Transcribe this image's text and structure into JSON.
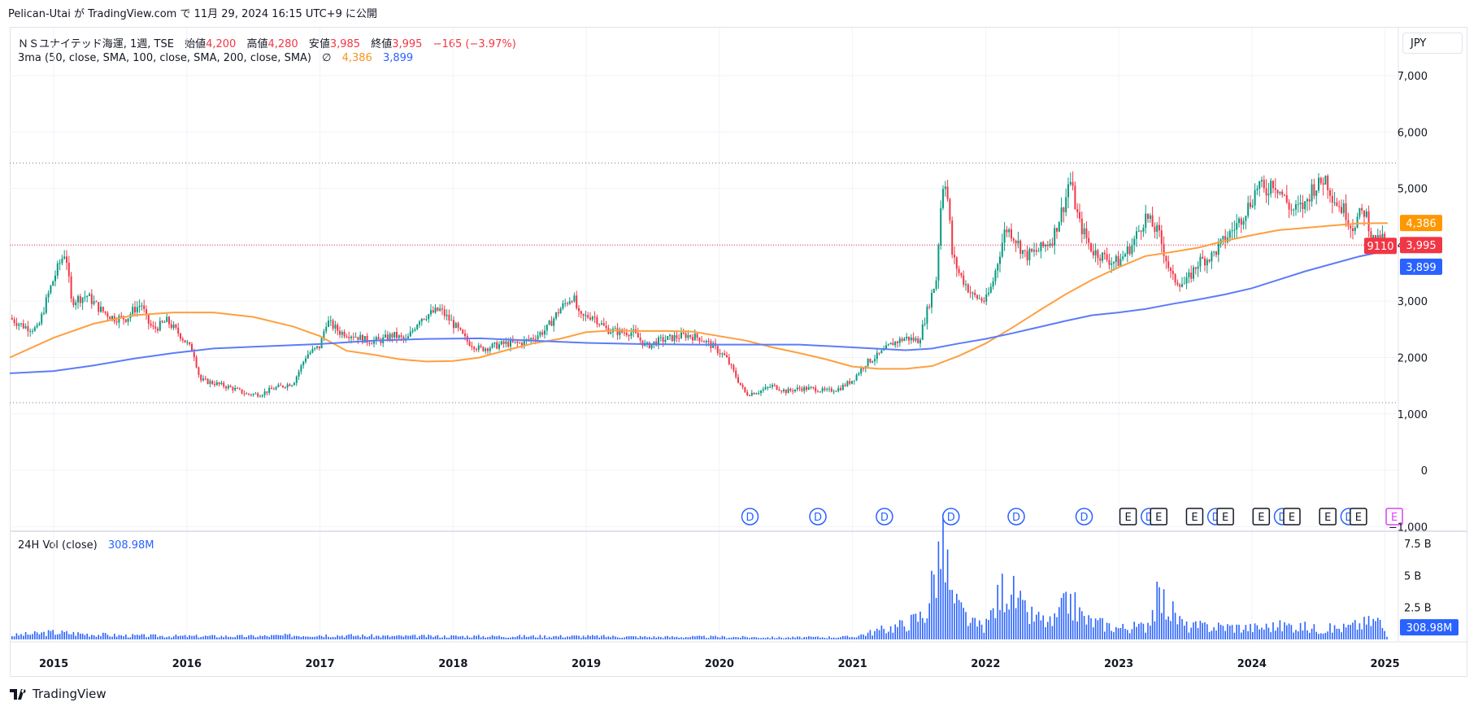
{
  "header": {
    "published_line": "Pelican-Utai が TradingView.com で 11月 29, 2024 16:15 UTC+9 に公開"
  },
  "legend": {
    "symbol": "ＮＳユナイテッド海運, 1週, TSE",
    "open_label": "始値",
    "open": "4,200",
    "high_label": "高値",
    "high": "4,280",
    "low_label": "安値",
    "low": "3,985",
    "close_label": "終値",
    "close": "3,995",
    "change": "−165 (−3.97%)",
    "indicator": "3ma (50, close, SMA, 100, close, SMA, 200, close, SMA)",
    "indicator_icon": "∅",
    "ma100_value": "4,386",
    "ma200_value": "3,899",
    "volume_label": "24H Vol (close)",
    "volume_value": "308.98M"
  },
  "currency": "JPY",
  "footer": {
    "brand": "TradingView"
  },
  "colors": {
    "up": "#089981",
    "down": "#f23645",
    "ma100": "#ff9f40",
    "ma200": "#5b7cfa",
    "volume": "#2962ff",
    "price_label": "#f23645",
    "ma100_label": "#ff9800",
    "ma200_label": "#2962ff"
  },
  "chart_data": {
    "type": "candlestick",
    "timeframe": "1W",
    "x_tick_labels": [
      "2015",
      "2016",
      "2017",
      "2018",
      "2019",
      "2020",
      "2021",
      "2022",
      "2023",
      "2024",
      "2025"
    ],
    "y_tick_labels": [
      "7,000",
      "6,000",
      "5,000",
      "4,000",
      "3,000",
      "2,000",
      "1,000",
      "0",
      "−1,000"
    ],
    "ylim": [
      -1000,
      7600
    ],
    "xlim": [
      2014.67,
      2025.1
    ],
    "horizontal_levels": [
      5450,
      1200
    ],
    "last_price_line": 3995,
    "price_labels": {
      "ticker": "9110",
      "last": "3,995",
      "ma100": "4,386",
      "ma200": "3,899"
    },
    "price_path": [
      [
        2014.67,
        2700
      ],
      [
        2014.78,
        2550
      ],
      [
        2014.88,
        2500
      ],
      [
        2014.95,
        3050
      ],
      [
        2015.0,
        3400
      ],
      [
        2015.05,
        3700
      ],
      [
        2015.09,
        3900
      ],
      [
        2015.13,
        3000
      ],
      [
        2015.25,
        3100
      ],
      [
        2015.35,
        2850
      ],
      [
        2015.45,
        2700
      ],
      [
        2015.55,
        2700
      ],
      [
        2015.6,
        2850
      ],
      [
        2015.66,
        2950
      ],
      [
        2015.7,
        2650
      ],
      [
        2015.75,
        2500
      ],
      [
        2015.85,
        2650
      ],
      [
        2015.95,
        2400
      ],
      [
        2016.05,
        2100
      ],
      [
        2016.1,
        1600
      ],
      [
        2016.2,
        1550
      ],
      [
        2016.35,
        1450
      ],
      [
        2016.45,
        1350
      ],
      [
        2016.55,
        1350
      ],
      [
        2016.65,
        1450
      ],
      [
        2016.8,
        1550
      ],
      [
        2016.85,
        1800
      ],
      [
        2016.9,
        2050
      ],
      [
        2017.0,
        2200
      ],
      [
        2017.05,
        2650
      ],
      [
        2017.15,
        2450
      ],
      [
        2017.25,
        2400
      ],
      [
        2017.35,
        2300
      ],
      [
        2017.45,
        2300
      ],
      [
        2017.55,
        2400
      ],
      [
        2017.65,
        2300
      ],
      [
        2017.75,
        2700
      ],
      [
        2017.9,
        2850
      ],
      [
        2018.0,
        2600
      ],
      [
        2018.1,
        2300
      ],
      [
        2018.2,
        2150
      ],
      [
        2018.3,
        2200
      ],
      [
        2018.4,
        2250
      ],
      [
        2018.5,
        2250
      ],
      [
        2018.6,
        2350
      ],
      [
        2018.7,
        2500
      ],
      [
        2018.8,
        2850
      ],
      [
        2018.9,
        3100
      ],
      [
        2018.95,
        2700
      ],
      [
        2019.05,
        2750
      ],
      [
        2019.15,
        2500
      ],
      [
        2019.25,
        2450
      ],
      [
        2019.35,
        2450
      ],
      [
        2019.45,
        2200
      ],
      [
        2019.55,
        2300
      ],
      [
        2019.65,
        2350
      ],
      [
        2019.75,
        2400
      ],
      [
        2019.85,
        2350
      ],
      [
        2019.95,
        2200
      ],
      [
        2020.05,
        2000
      ],
      [
        2020.15,
        1550
      ],
      [
        2020.2,
        1350
      ],
      [
        2020.3,
        1400
      ],
      [
        2020.4,
        1500
      ],
      [
        2020.5,
        1400
      ],
      [
        2020.6,
        1450
      ],
      [
        2020.7,
        1450
      ],
      [
        2020.8,
        1400
      ],
      [
        2020.9,
        1450
      ],
      [
        2021.0,
        1600
      ],
      [
        2021.1,
        1900
      ],
      [
        2021.2,
        2050
      ],
      [
        2021.3,
        2250
      ],
      [
        2021.4,
        2350
      ],
      [
        2021.5,
        2300
      ],
      [
        2021.58,
        3000
      ],
      [
        2021.63,
        3400
      ],
      [
        2021.66,
        4600
      ],
      [
        2021.69,
        5300
      ],
      [
        2021.72,
        4700
      ],
      [
        2021.75,
        3800
      ],
      [
        2021.8,
        3500
      ],
      [
        2021.9,
        3100
      ],
      [
        2022.0,
        3000
      ],
      [
        2022.05,
        3300
      ],
      [
        2022.15,
        4300
      ],
      [
        2022.2,
        4200
      ],
      [
        2022.3,
        3800
      ],
      [
        2022.4,
        3900
      ],
      [
        2022.5,
        4100
      ],
      [
        2022.6,
        4800
      ],
      [
        2022.63,
        5200
      ],
      [
        2022.7,
        4400
      ],
      [
        2022.8,
        3900
      ],
      [
        2022.95,
        3700
      ],
      [
        2023.0,
        3700
      ],
      [
        2023.1,
        4000
      ],
      [
        2023.2,
        4500
      ],
      [
        2023.3,
        4200
      ],
      [
        2023.4,
        3400
      ],
      [
        2023.5,
        3300
      ],
      [
        2023.6,
        3700
      ],
      [
        2023.7,
        3800
      ],
      [
        2023.8,
        4100
      ],
      [
        2023.9,
        4400
      ],
      [
        2024.0,
        4800
      ],
      [
        2024.05,
        5100
      ],
      [
        2024.1,
        4900
      ],
      [
        2024.15,
        5150
      ],
      [
        2024.2,
        5000
      ],
      [
        2024.3,
        4600
      ],
      [
        2024.4,
        4700
      ],
      [
        2024.45,
        5000
      ],
      [
        2024.5,
        5050
      ],
      [
        2024.55,
        5200
      ],
      [
        2024.6,
        4900
      ],
      [
        2024.65,
        4700
      ],
      [
        2024.7,
        4600
      ],
      [
        2024.75,
        4300
      ],
      [
        2024.8,
        4500
      ],
      [
        2024.85,
        4600
      ],
      [
        2024.88,
        4350
      ],
      [
        2024.9,
        4100
      ],
      [
        2024.95,
        4050
      ],
      [
        2024.98,
        4120
      ],
      [
        2025.0,
        4050
      ],
      [
        2025.02,
        3995
      ]
    ],
    "series": [
      {
        "name": "MA100",
        "points": [
          [
            2014.67,
            2000
          ],
          [
            2015.0,
            2350
          ],
          [
            2015.3,
            2600
          ],
          [
            2015.6,
            2750
          ],
          [
            2015.9,
            2800
          ],
          [
            2016.2,
            2800
          ],
          [
            2016.5,
            2720
          ],
          [
            2016.8,
            2550
          ],
          [
            2017.0,
            2380
          ],
          [
            2017.2,
            2120
          ],
          [
            2017.4,
            2050
          ],
          [
            2017.6,
            1970
          ],
          [
            2017.8,
            1930
          ],
          [
            2018.0,
            1940
          ],
          [
            2018.2,
            2000
          ],
          [
            2018.4,
            2130
          ],
          [
            2018.6,
            2250
          ],
          [
            2018.8,
            2330
          ],
          [
            2019.0,
            2450
          ],
          [
            2019.2,
            2480
          ],
          [
            2019.4,
            2470
          ],
          [
            2019.6,
            2470
          ],
          [
            2019.8,
            2460
          ],
          [
            2020.0,
            2380
          ],
          [
            2020.2,
            2300
          ],
          [
            2020.4,
            2180
          ],
          [
            2020.6,
            2080
          ],
          [
            2020.8,
            1970
          ],
          [
            2021.0,
            1840
          ],
          [
            2021.2,
            1800
          ],
          [
            2021.4,
            1800
          ],
          [
            2021.6,
            1850
          ],
          [
            2021.8,
            2030
          ],
          [
            2022.0,
            2250
          ],
          [
            2022.2,
            2530
          ],
          [
            2022.4,
            2830
          ],
          [
            2022.6,
            3120
          ],
          [
            2022.8,
            3380
          ],
          [
            2023.0,
            3600
          ],
          [
            2023.2,
            3800
          ],
          [
            2023.4,
            3870
          ],
          [
            2023.6,
            3950
          ],
          [
            2023.8,
            4070
          ],
          [
            2024.0,
            4170
          ],
          [
            2024.2,
            4260
          ],
          [
            2024.4,
            4300
          ],
          [
            2024.6,
            4340
          ],
          [
            2024.8,
            4380
          ],
          [
            2025.02,
            4386
          ]
        ]
      },
      {
        "name": "MA200",
        "points": [
          [
            2014.67,
            1720
          ],
          [
            2015.0,
            1760
          ],
          [
            2015.3,
            1860
          ],
          [
            2015.6,
            1980
          ],
          [
            2015.9,
            2080
          ],
          [
            2016.2,
            2160
          ],
          [
            2016.5,
            2190
          ],
          [
            2016.8,
            2220
          ],
          [
            2017.0,
            2240
          ],
          [
            2017.4,
            2300
          ],
          [
            2017.8,
            2330
          ],
          [
            2018.2,
            2340
          ],
          [
            2018.6,
            2300
          ],
          [
            2019.0,
            2260
          ],
          [
            2019.4,
            2240
          ],
          [
            2019.8,
            2230
          ],
          [
            2020.2,
            2230
          ],
          [
            2020.6,
            2230
          ],
          [
            2021.0,
            2180
          ],
          [
            2021.4,
            2130
          ],
          [
            2021.6,
            2160
          ],
          [
            2021.8,
            2250
          ],
          [
            2022.0,
            2330
          ],
          [
            2022.2,
            2430
          ],
          [
            2022.4,
            2540
          ],
          [
            2022.6,
            2650
          ],
          [
            2022.8,
            2750
          ],
          [
            2023.0,
            2800
          ],
          [
            2023.2,
            2860
          ],
          [
            2023.4,
            2950
          ],
          [
            2023.6,
            3030
          ],
          [
            2023.8,
            3120
          ],
          [
            2024.0,
            3230
          ],
          [
            2024.2,
            3380
          ],
          [
            2024.4,
            3530
          ],
          [
            2024.6,
            3660
          ],
          [
            2024.8,
            3790
          ],
          [
            2025.02,
            3899
          ]
        ]
      }
    ],
    "volume_axis_labels": [
      "7.5 B",
      "5 B",
      "2.5 B"
    ],
    "volume_last_label": "308.98M",
    "volume_profile": [
      [
        2014.67,
        0.3
      ],
      [
        2015.0,
        0.55
      ],
      [
        2015.5,
        0.3
      ],
      [
        2016.0,
        0.25
      ],
      [
        2016.5,
        0.25
      ],
      [
        2017.0,
        0.35
      ],
      [
        2017.5,
        0.25
      ],
      [
        2018.0,
        0.25
      ],
      [
        2018.5,
        0.25
      ],
      [
        2019.0,
        0.25
      ],
      [
        2019.5,
        0.2
      ],
      [
        2020.0,
        0.2
      ],
      [
        2020.5,
        0.15
      ],
      [
        2021.0,
        0.2
      ],
      [
        2021.2,
        0.7
      ],
      [
        2021.4,
        1.2
      ],
      [
        2021.55,
        2.0
      ],
      [
        2021.66,
        7.1
      ],
      [
        2021.7,
        6.4
      ],
      [
        2021.75,
        3.0
      ],
      [
        2021.9,
        1.2
      ],
      [
        2022.0,
        1.0
      ],
      [
        2022.15,
        4.4
      ],
      [
        2022.3,
        2.0
      ],
      [
        2022.5,
        1.2
      ],
      [
        2022.63,
        3.1
      ],
      [
        2022.75,
        1.5
      ],
      [
        2023.0,
        0.9
      ],
      [
        2023.2,
        1.0
      ],
      [
        2023.3,
        3.3
      ],
      [
        2023.5,
        1.0
      ],
      [
        2023.8,
        1.0
      ],
      [
        2024.0,
        0.9
      ],
      [
        2024.3,
        1.1
      ],
      [
        2024.5,
        0.8
      ],
      [
        2024.7,
        0.9
      ],
      [
        2024.95,
        1.5
      ],
      [
        2025.02,
        0.31
      ]
    ],
    "event_markers": [
      {
        "label": "D",
        "x": 2020.23
      },
      {
        "label": "D",
        "x": 2020.74
      },
      {
        "label": "D",
        "x": 2021.24
      },
      {
        "label": "D",
        "x": 2021.74
      },
      {
        "label": "D",
        "x": 2022.23
      },
      {
        "label": "D",
        "x": 2022.74
      },
      {
        "label": "E",
        "x": 2023.07
      },
      {
        "label": "D",
        "x": 2023.23
      },
      {
        "label": "E",
        "x": 2023.3
      },
      {
        "label": "E",
        "x": 2023.57
      },
      {
        "label": "D",
        "x": 2023.73
      },
      {
        "label": "E",
        "x": 2023.8
      },
      {
        "label": "E",
        "x": 2024.07
      },
      {
        "label": "D",
        "x": 2024.23
      },
      {
        "label": "E",
        "x": 2024.3
      },
      {
        "label": "E",
        "x": 2024.57
      },
      {
        "label": "D",
        "x": 2024.73
      },
      {
        "label": "E",
        "x": 2024.8
      },
      {
        "label": "E",
        "x": 2025.07
      }
    ]
  }
}
